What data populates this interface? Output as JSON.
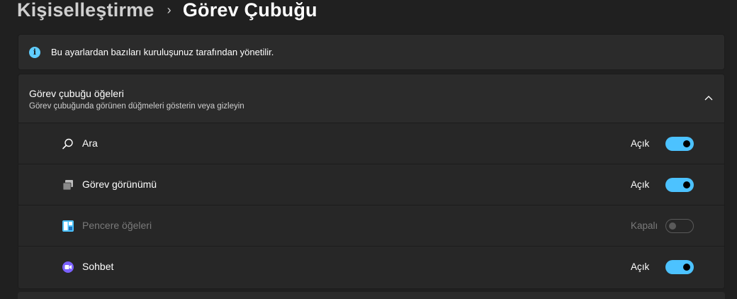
{
  "breadcrumb": {
    "parent": "Kişiselleştirme",
    "separator": "›",
    "current": "Görev Çubuğu"
  },
  "info": {
    "text": "Bu ayarlardan bazıları kuruluşunuz tarafından yönetilir.",
    "icon": "info-icon"
  },
  "group": {
    "title": "Görev çubuğu öğeleri",
    "subtitle": "Görev çubuğunda görünen düğmeleri gösterin veya gizleyin",
    "expanded": true,
    "items": [
      {
        "label": "Ara",
        "icon": "search-icon",
        "state_label": "Açık",
        "on": true,
        "enabled": true
      },
      {
        "label": "Görev görünümü",
        "icon": "task-view-icon",
        "state_label": "Açık",
        "on": true,
        "enabled": true
      },
      {
        "label": "Pencere öğeleri",
        "icon": "widgets-icon",
        "state_label": "Kapalı",
        "on": false,
        "enabled": false
      },
      {
        "label": "Sohbet",
        "icon": "chat-icon",
        "state_label": "Açık",
        "on": true,
        "enabled": true
      }
    ]
  },
  "colors": {
    "accent": "#4cc2ff",
    "background": "#202020",
    "card": "#2b2b2b"
  }
}
